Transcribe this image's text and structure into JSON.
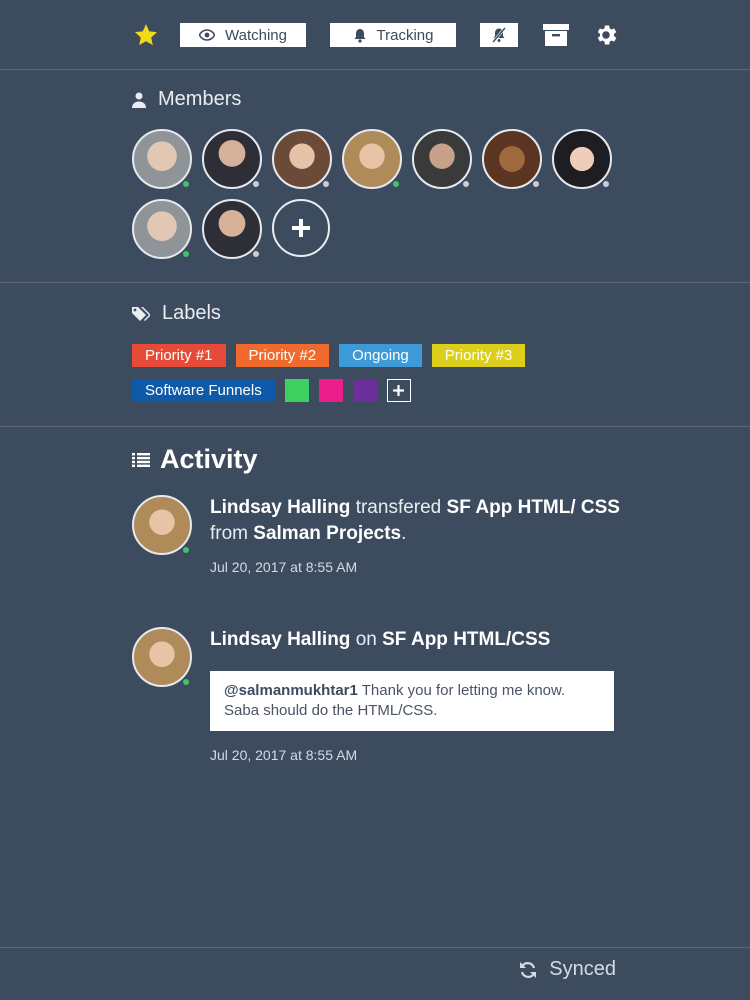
{
  "toolbar": {
    "watching_label": "Watching",
    "tracking_label": "Tracking",
    "star_color": "#f2d918"
  },
  "members": {
    "title": "Members",
    "avatars": [
      {
        "name": "member-1",
        "status_color": "#3fc46a"
      },
      {
        "name": "member-2",
        "status_color": "#c9ced6"
      },
      {
        "name": "member-3",
        "status_color": "#c9ced6"
      },
      {
        "name": "member-4",
        "status_color": "#3fc46a"
      },
      {
        "name": "member-5",
        "status_color": "#c9ced6"
      },
      {
        "name": "member-6",
        "status_color": "#c9ced6"
      },
      {
        "name": "member-7",
        "status_color": "#c9ced6"
      },
      {
        "name": "member-8",
        "status_color": "#3fc46a"
      },
      {
        "name": "member-9",
        "status_color": "#c9ced6"
      }
    ]
  },
  "labels": {
    "title": "Labels",
    "items": [
      {
        "text": "Priority #1",
        "color": "#e54b38"
      },
      {
        "text": "Priority #2",
        "color": "#ef6a2c"
      },
      {
        "text": "Ongoing",
        "color": "#3d9ad8"
      },
      {
        "text": "Priority #3",
        "color": "#dccf1c"
      },
      {
        "text": "Software Funnels",
        "color": "#0f5aa8"
      }
    ],
    "swatches": [
      "#3fd062",
      "#ec1e8c",
      "#6a2f99"
    ]
  },
  "activity": {
    "title": "Activity",
    "entries": [
      {
        "user": "Lindsay Halling",
        "verb": "transfered",
        "object": "SF App HTML/ CSS",
        "preposition": "from",
        "target": "Salman Projects",
        "end": ".",
        "time": "Jul 20, 2017 at 8:55 AM"
      },
      {
        "user": "Lindsay Halling",
        "verb": "on",
        "object": "SF App HTML/CSS",
        "comment_mention": "@salmanmukhtar1",
        "comment_text": "Thank you for letting me know. Saba should do the HTML/CSS.",
        "time": "Jul 20, 2017 at 8:55 AM"
      }
    ]
  },
  "footer": {
    "status": "Synced"
  }
}
